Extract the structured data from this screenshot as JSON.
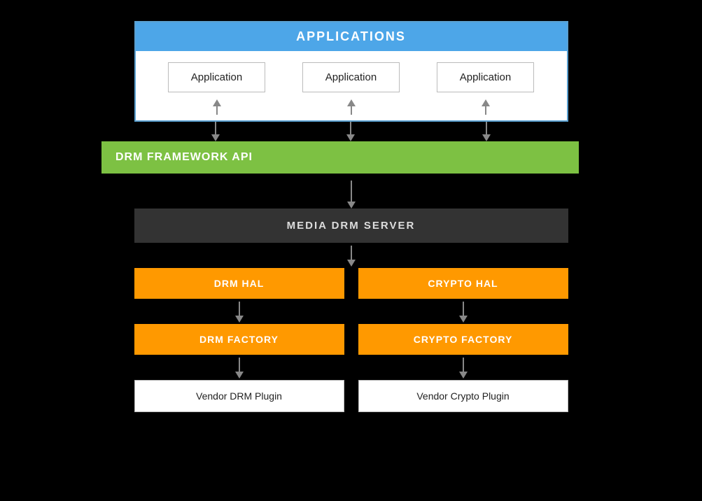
{
  "applications": {
    "header": "APPLICATIONS",
    "boxes": [
      "Application",
      "Application",
      "Application"
    ]
  },
  "drm_framework": {
    "label": "DRM FRAMEWORK API"
  },
  "media_drm_server": {
    "label": "MEDIA DRM SERVER"
  },
  "hal_row": {
    "left": "DRM HAL",
    "right": "CRYPTO HAL"
  },
  "factory_row": {
    "left": "DRM FACTORY",
    "right": "CRYPTO FACTORY"
  },
  "vendor_row": {
    "left": "Vendor DRM Plugin",
    "right": "Vendor Crypto Plugin"
  },
  "colors": {
    "bg": "#000000",
    "applications_header": "#4da6e8",
    "applications_border": "#5aa0d0",
    "drm_framework": "#7dc143",
    "media_drm_server": "#333333",
    "hal_factory": "#ff9900",
    "vendor_bg": "#ffffff"
  }
}
